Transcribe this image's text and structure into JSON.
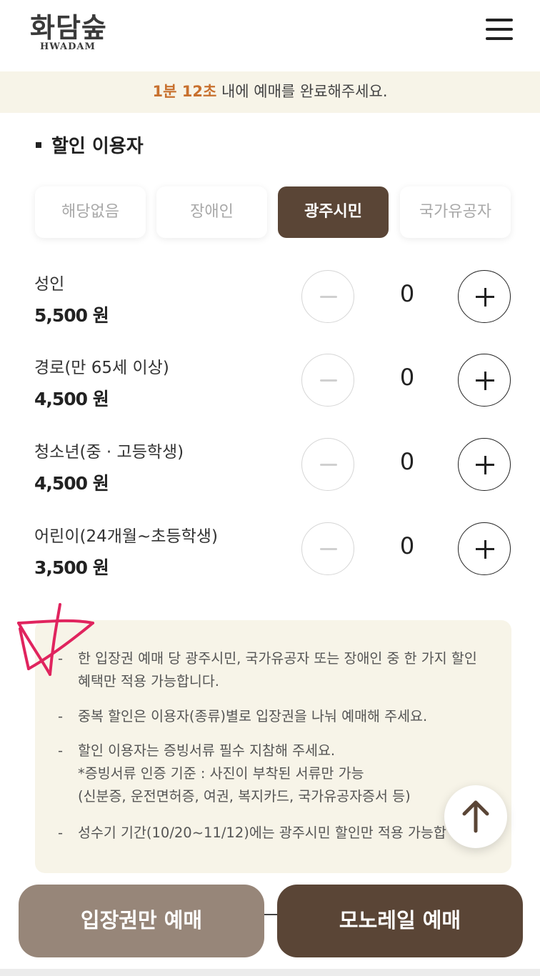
{
  "header": {
    "logo_text": "화담숲",
    "logo_sub": "HWADAM",
    "menu_icon": "hamburger-menu-icon"
  },
  "timer": {
    "time": "1분 12초",
    "message": " 내에 예매를 완료해주세요."
  },
  "section": {
    "title": "할인 이용자"
  },
  "discount_types": [
    {
      "label": "해당없음",
      "selected": false
    },
    {
      "label": "장애인",
      "selected": false
    },
    {
      "label": "광주시민",
      "selected": true
    },
    {
      "label": "국가유공자",
      "selected": false
    }
  ],
  "tickets": [
    {
      "label": "성인",
      "price": "5,500 원",
      "quantity": "0"
    },
    {
      "label": "경로(만 65세 이상)",
      "price": "4,500 원",
      "quantity": "0"
    },
    {
      "label": "청소년(중 · 고등학생)",
      "price": "4,500 원",
      "quantity": "0"
    },
    {
      "label": "어린이(24개월~초등학생)",
      "price": "3,500 원",
      "quantity": "0"
    }
  ],
  "notice": {
    "dash": "-",
    "items": [
      {
        "line1": "한 입장권 예매 당 광주시민, 국가유공자 또는 장애인 중 한 가지 할인",
        "line2": "혜택만 적용 가능합니다."
      },
      {
        "line1": "중복 할인은 이용자(종류)별로 입장권을 나눠 예매해 주세요."
      },
      {
        "line1": "할인 이용자는 증빙서류 필수 지참해 주세요.",
        "line2": "*증빙서류 인증 기준 : 사진이 부착된 서류만 가능",
        "line3": "(신분증, 운전면허증, 여권, 복지카드, 국가유공자증서 등)"
      },
      {
        "line1": "성수기 기간(10/20~11/12)에는 광주시민 할인만 적용 가능합"
      }
    ]
  },
  "buttons": {
    "ticket_only": "입장권만 예매",
    "monorail": "모노레일 예매"
  },
  "colors": {
    "brand_dark": "#5a4536",
    "brand_light": "#978679",
    "timer_accent": "#c8702e",
    "notice_bg": "#f7f4e8",
    "annotation": "#e0245e"
  }
}
